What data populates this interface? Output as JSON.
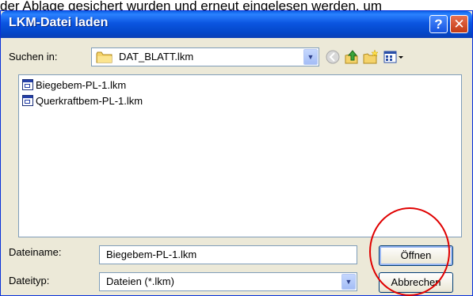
{
  "caption": "der Ablage gesichert wurden und erneut eingelesen werden, um",
  "window": {
    "title": "LKM-Datei laden"
  },
  "lookin": {
    "label": "Suchen in:",
    "accesskey": "S",
    "value": "DAT_BLATT.lkm"
  },
  "files": [
    {
      "name": "Biegebem-PL-1.lkm"
    },
    {
      "name": "Querkraftbem-PL-1.lkm"
    }
  ],
  "filename": {
    "label": "Dateiname:",
    "value": "Biegebem-PL-1.lkm"
  },
  "filetype": {
    "label": "Dateityp:",
    "value": "Dateien (*.lkm)"
  },
  "buttons": {
    "open": "Öffnen",
    "cancel": "Abbrechen"
  },
  "titlebar_buttons": {
    "help": "?",
    "close": "✕"
  },
  "colors": {
    "titlebar": "#0a55e0",
    "face": "#ece9d8",
    "highlight_circle": "#e00000"
  }
}
